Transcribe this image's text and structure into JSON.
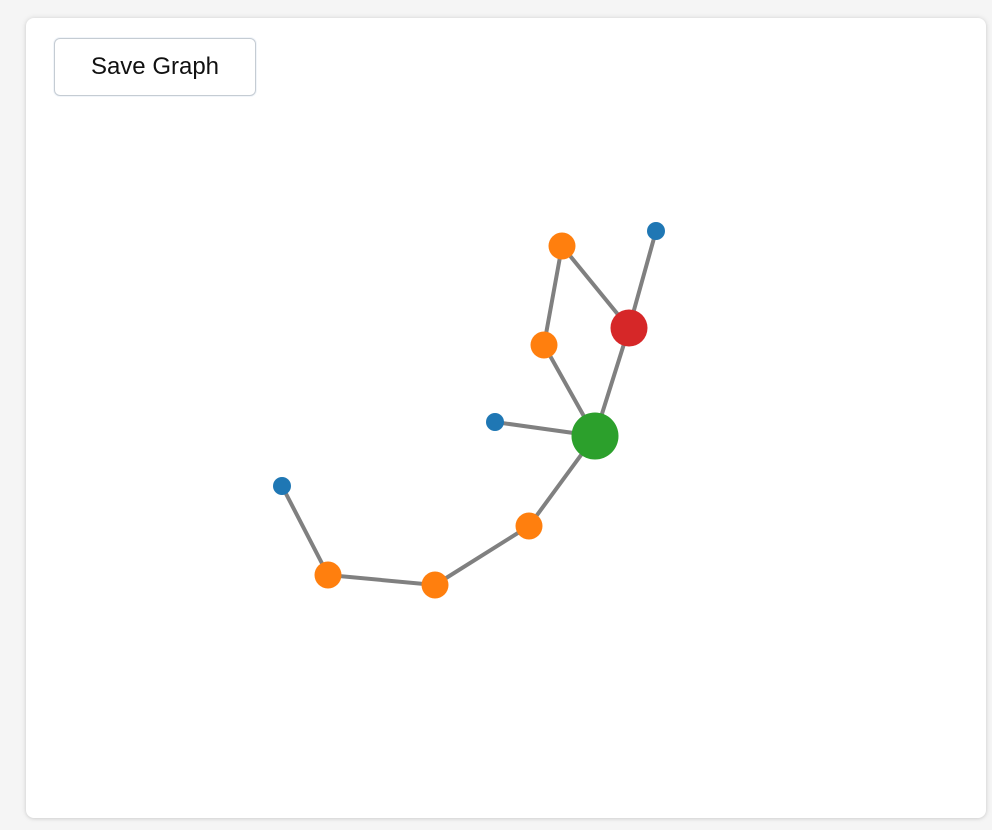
{
  "toolbar": {
    "save_label": "Save Graph"
  },
  "graph": {
    "edge_color": "#808080",
    "nodes": [
      {
        "id": "n1",
        "color": "#1f77b4",
        "size": "small"
      },
      {
        "id": "n2",
        "color": "#ff7f0e",
        "size": "medium"
      },
      {
        "id": "n3",
        "color": "#ff7f0e",
        "size": "medium"
      },
      {
        "id": "n4",
        "color": "#ff7f0e",
        "size": "medium"
      },
      {
        "id": "n5",
        "color": "#2ca02c",
        "size": "large"
      },
      {
        "id": "n6",
        "color": "#1f77b4",
        "size": "small"
      },
      {
        "id": "n7",
        "color": "#ff7f0e",
        "size": "medium"
      },
      {
        "id": "n8",
        "color": "#d62728",
        "size": "medium-large"
      },
      {
        "id": "n9",
        "color": "#ff7f0e",
        "size": "medium"
      },
      {
        "id": "n10",
        "color": "#1f77b4",
        "size": "small"
      }
    ],
    "edges": [
      [
        "n1",
        "n2"
      ],
      [
        "n2",
        "n3"
      ],
      [
        "n3",
        "n4"
      ],
      [
        "n4",
        "n5"
      ],
      [
        "n6",
        "n5"
      ],
      [
        "n5",
        "n7"
      ],
      [
        "n5",
        "n8"
      ],
      [
        "n7",
        "n9"
      ],
      [
        "n9",
        "n8"
      ],
      [
        "n8",
        "n10"
      ]
    ]
  }
}
